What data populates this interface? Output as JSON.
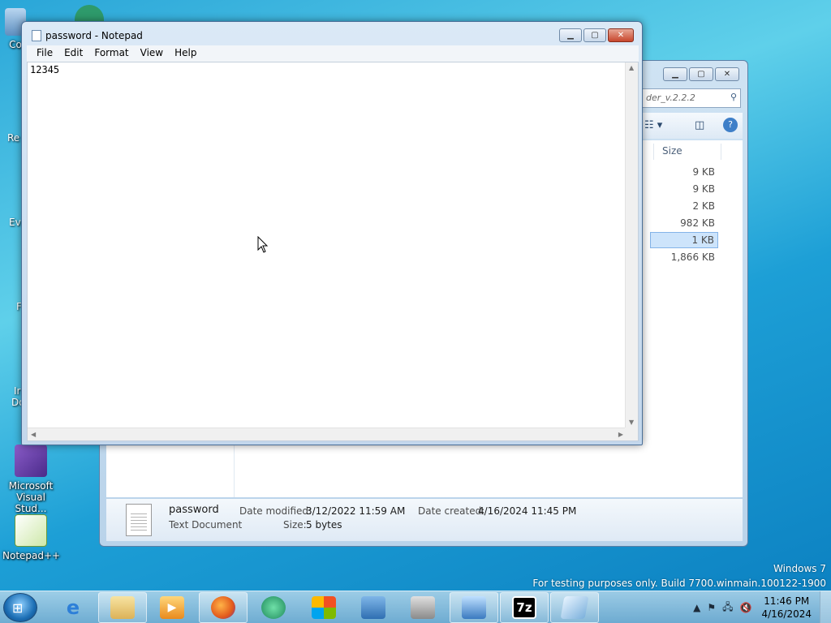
{
  "desktop": {
    "icons": [
      {
        "label": "Microsoft Visual Stud...",
        "icon": "visual-studio-icon"
      },
      {
        "label": "Notepad++",
        "icon": "notepadpp-icon"
      }
    ],
    "cut_labels": [
      "Co",
      "Re",
      "Ev",
      "F",
      "Ir",
      "Do"
    ]
  },
  "explorer": {
    "search_text": "der_v.2.2.2",
    "column_size": "Size",
    "sizes": [
      "9 KB",
      "9 KB",
      "2 KB",
      "982 KB",
      "1 KB",
      "1,866 KB"
    ],
    "selected_index": 4,
    "details": {
      "name": "password",
      "type": "Text Document",
      "date_modified_label": "Date modified:",
      "date_modified": "3/12/2022 11:59 AM",
      "size_label": "Size:",
      "size": "5 bytes",
      "date_created_label": "Date created:",
      "date_created": "4/16/2024 11:45 PM"
    }
  },
  "notepad": {
    "title": "password - Notepad",
    "menu": [
      "File",
      "Edit",
      "Format",
      "View",
      "Help"
    ],
    "content": "12345"
  },
  "watermark": {
    "line1": "Windows 7",
    "line2": "For testing purposes only. Build 7700.winmain.100122-1900"
  },
  "taskbar": {
    "time": "11:46 PM",
    "date": "4/16/2024",
    "items": [
      "internet-explorer-icon",
      "explorer-folder-icon",
      "media-player-icon",
      "firefox-icon",
      "green-app-icon",
      "windows-flag-icon",
      "control-panel-icon",
      "device-icon",
      "remote-desktop-icon",
      "7zip-icon",
      "notepad-icon"
    ],
    "seven_zip_label": "7z"
  }
}
